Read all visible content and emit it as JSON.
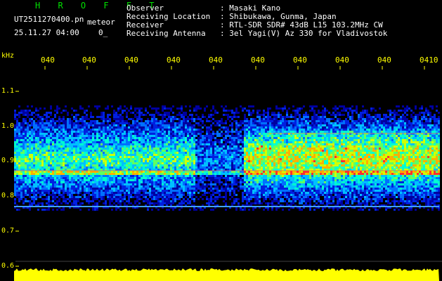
{
  "header": {
    "title": "H R O F F T",
    "filename": "UT2511270400.pn",
    "mode": "meteor",
    "date": "25.11.27 04:00",
    "counter": "0_",
    "labels": [
      "Observer",
      "Receiving Location",
      "Receiver",
      "Receiving Antenna"
    ],
    "values": [
      ": Masaki Kano",
      ": Shibukawa, Gunma, Japan",
      ": RTL-SDR SDR# 43dB L15 103.2MHz CW",
      ": 3el Yagi(V) Az 330 for Vladivostok"
    ]
  },
  "chart_data": {
    "type": "heatmap",
    "ylabel": "kHz",
    "yticks": [
      "1.1",
      "1.0",
      "0.9",
      "0.8",
      "0.7",
      "0.6"
    ],
    "xticks": [
      "040",
      "040",
      "040",
      "040",
      "040",
      "040",
      "040",
      "040",
      "040",
      "0410"
    ]
  },
  "colors": {
    "background": "#000000",
    "title": "#00e000",
    "axis": "#ffff00",
    "text": "#ffffff"
  }
}
